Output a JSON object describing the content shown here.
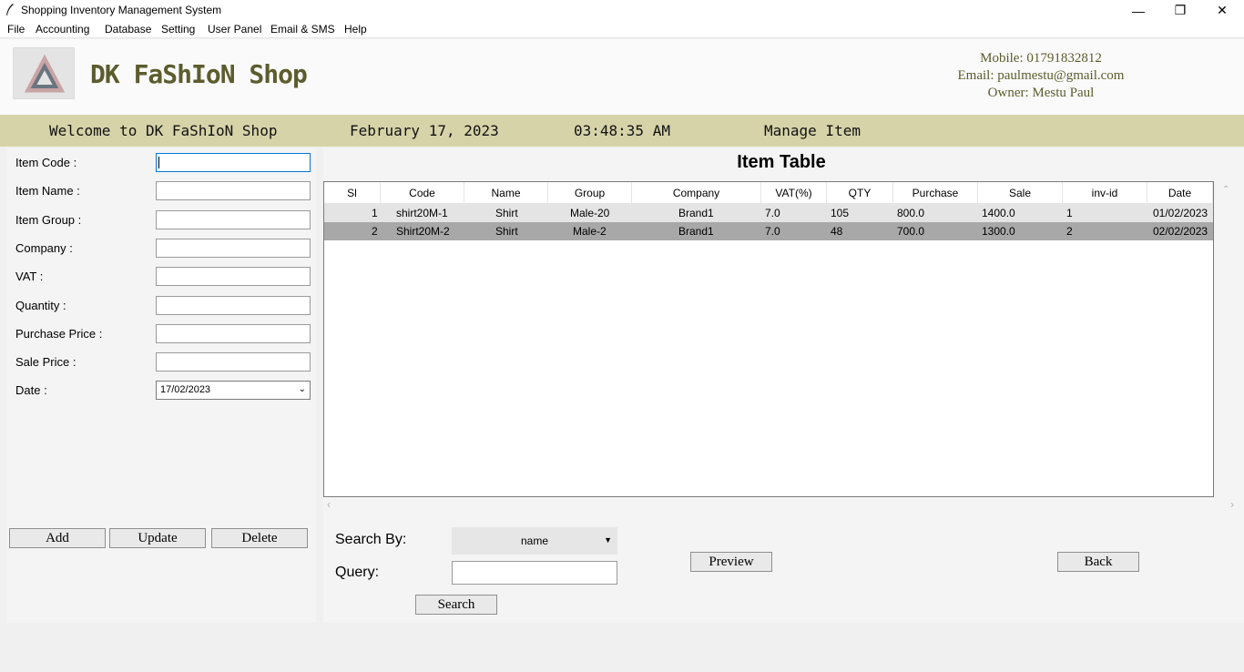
{
  "window": {
    "title": "Shopping Inventory Management System",
    "minimize": "—",
    "restore": "❐",
    "close": "✕"
  },
  "menu": [
    "File",
    "Accounting",
    "Database",
    "Setting",
    "User Panel",
    "Email & SMS",
    "Help"
  ],
  "header": {
    "shop_name": "DK FaShIoN Shop",
    "mobile": "Mobile: 01791832812",
    "email": "Email: paulmestu@gmail.com",
    "owner": "Owner: Mestu Paul"
  },
  "infobar": {
    "welcome": "Welcome to DK FaShIoN Shop",
    "date": "February 17, 2023",
    "time": "03:48:35 AM",
    "section": "Manage Item"
  },
  "form": {
    "item_code": "Item Code :",
    "item_name": "Item Name :",
    "item_group": "Item Group :",
    "company": "Company :",
    "vat": "VAT :",
    "quantity": "Quantity :",
    "purchase_price": "Purchase Price :",
    "sale_price": "Sale Price :",
    "date": "Date :",
    "date_value": "17/02/2023"
  },
  "buttons": {
    "add": "Add",
    "update": "Update",
    "delete": "Delete",
    "preview": "Preview",
    "back": "Back",
    "search": "Search"
  },
  "table": {
    "title": "Item Table",
    "headers": [
      "Sl",
      "Code",
      "Name",
      "Group",
      "Company",
      "VAT(%)",
      "QTY",
      "Purchase",
      "Sale",
      "inv-id",
      "Date"
    ],
    "rows": [
      [
        "1",
        "shirt20M-1",
        "Shirt",
        "Male-20",
        "Brand1",
        "7.0",
        "105",
        "800.0",
        "1400.0",
        "1",
        "01/02/2023"
      ],
      [
        "2",
        "Shirt20M-2",
        "Shirt",
        "Male-2",
        "Brand1",
        "7.0",
        "48",
        "700.0",
        "1300.0",
        "2",
        "02/02/2023"
      ]
    ]
  },
  "search": {
    "by_label": "Search By:",
    "by_value": "name",
    "query_label": "Query:"
  },
  "colors": {
    "infobar_bg": "#d6d3a8",
    "brand_text": "#5c5c2e",
    "selected_row": "#a8a8a8"
  },
  "icons": {
    "app": "feather-icon",
    "logo": "triangle-logo-icon"
  }
}
